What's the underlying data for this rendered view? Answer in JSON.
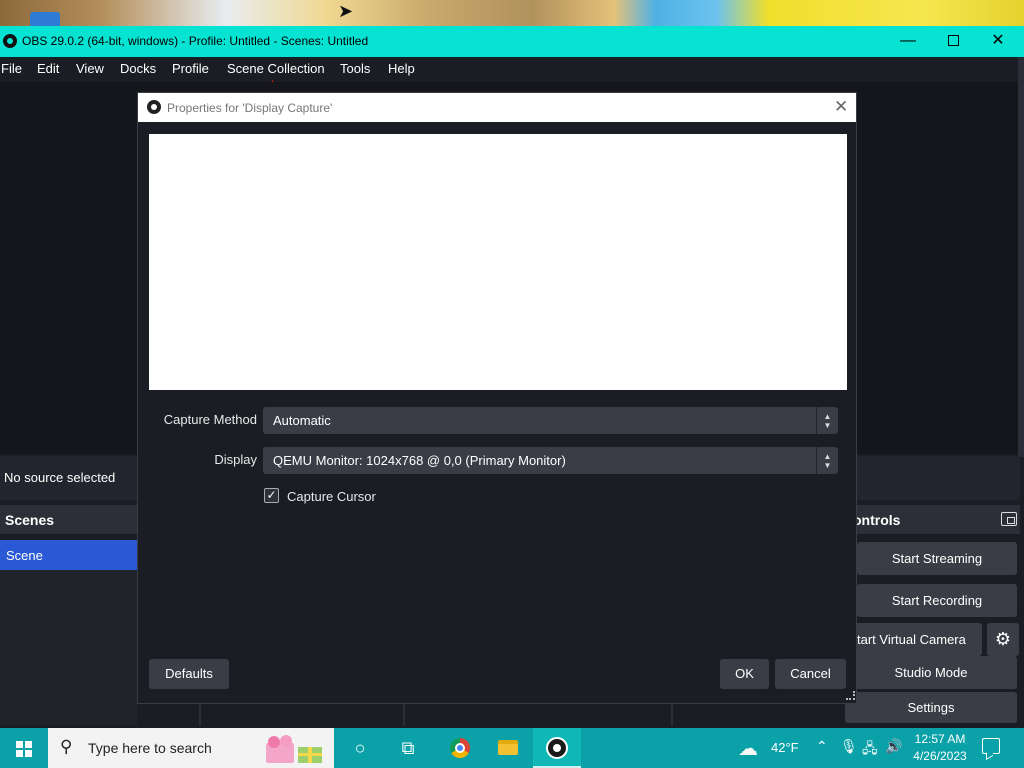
{
  "window": {
    "title": "OBS 29.0.2 (64-bit, windows) - Profile: Untitled - Scenes: Untitled",
    "min_symbol": "—",
    "close_symbol": "✕"
  },
  "menu": {
    "items": [
      "File",
      "Edit",
      "View",
      "Docks",
      "Profile",
      "Scene Collection",
      "Tools",
      "Help"
    ]
  },
  "sources": {
    "no_source_label": "No source selected"
  },
  "scenes": {
    "title": "Scenes",
    "items": [
      "Scene"
    ]
  },
  "controls": {
    "title": "ontrols",
    "start_streaming": "Start Streaming",
    "start_recording": "Start Recording",
    "start_virtual_camera": "tart Virtual Camera",
    "studio_mode": "Studio Mode",
    "settings": "Settings",
    "gear_symbol": "⚙"
  },
  "dialog": {
    "title": "Properties for 'Display Capture'",
    "close_symbol": "✕",
    "capture_method": {
      "label": "Capture Method",
      "value": "Automatic"
    },
    "display": {
      "label": "Display",
      "value": "QEMU Monitor: 1024x768 @ 0,0 (Primary Monitor)"
    },
    "capture_cursor": {
      "label": "Capture Cursor",
      "checked": true,
      "check_symbol": "✓"
    },
    "buttons": {
      "defaults": "Defaults",
      "ok": "OK",
      "cancel": "Cancel"
    }
  },
  "taskbar": {
    "search_placeholder": "Type here to search",
    "weather": "42°F",
    "time": "12:57 AM",
    "date": "4/26/2023",
    "icons": [
      "windows-start-icon",
      "search-icon",
      "cortana-icon",
      "task-view-icon",
      "chrome-icon",
      "file-explorer-icon",
      "obs-icon",
      "weather-icon",
      "chevron-up-icon",
      "microphone-icon",
      "network-icon",
      "volume-icon",
      "notification-icon"
    ]
  },
  "colors": {
    "titlebar": "#07e3d3",
    "obs_bg": "#1a1d24",
    "button": "#3a3d46",
    "scene_selected": "#2a59d6",
    "taskbar": "#0aa2a8"
  }
}
